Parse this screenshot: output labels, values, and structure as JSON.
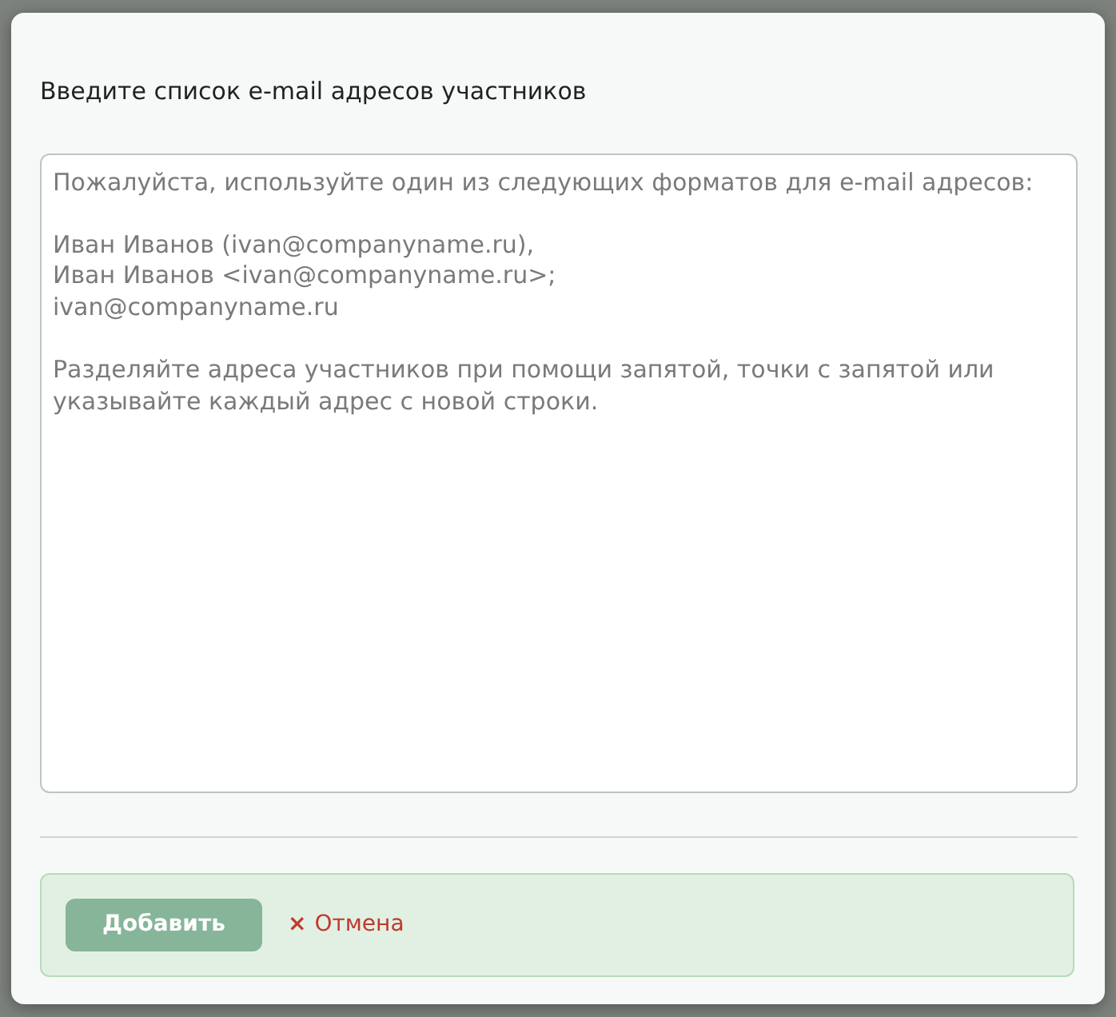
{
  "dialog": {
    "title": "Введите список e-mail адресов участников",
    "textarea": {
      "placeholder": "Пожалуйста, используйте один из следующих форматов для e-mail адресов:\n\nИван Иванов (ivan@companyname.ru),\nИван Иванов <ivan@companyname.ru>;\nivan@companyname.ru\n\nРазделяйте адреса участников при помощи запятой, точки с запятой или указывайте каждый адрес с новой строки."
    },
    "buttons": [
      {
        "kind": "primary",
        "label": "Добавить",
        "disabled": true
      },
      {
        "kind": "cancel",
        "icon": "×",
        "label": "Отмена"
      }
    ]
  }
}
